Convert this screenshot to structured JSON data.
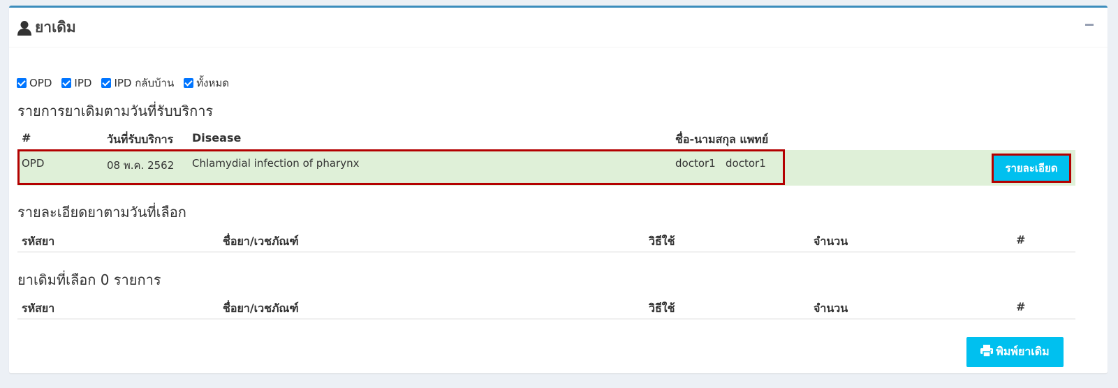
{
  "panel": {
    "title": "ยาเดิม",
    "title_icon": "user-icon",
    "collapse_icon": "minus-icon"
  },
  "filters": [
    {
      "label": "OPD",
      "checked": true
    },
    {
      "label": "IPD",
      "checked": true
    },
    {
      "label": "IPD กลับบ้าน",
      "checked": true
    },
    {
      "label": "ทั้งหมด",
      "checked": true
    }
  ],
  "visits": {
    "title": "รายการยาเดิมตามวันที่รับบริการ",
    "columns": [
      "#",
      "วันที่รับบริการ",
      "Disease",
      "ชื่อ-นามสกุล แพทย์"
    ],
    "rows": [
      {
        "type": "OPD",
        "date": "08 พ.ค. 2562",
        "disease": "Chlamydial infection of pharynx",
        "doctor": "doctor1   doctor1",
        "action_label": "รายละเอียด"
      }
    ]
  },
  "detail": {
    "title": "รายละเอียดยาตามวันที่เลือก",
    "columns": [
      "รหัสยา",
      "ชื่อยา/เวชภัณฑ์",
      "วิธีใช้",
      "จำนวน",
      "#"
    ]
  },
  "selected": {
    "title": "ยาเดิมที่เลือก 0 รายการ",
    "columns": [
      "รหัสยา",
      "ชื่อยา/เวชภัณฑ์",
      "วิธีใช้",
      "จำนวน",
      "#"
    ]
  },
  "print_button": {
    "label": "พิมพ์ยาเดิม",
    "icon": "print-icon"
  },
  "colors": {
    "accent": "#3c8dbc",
    "info": "#00c0ef",
    "row_success": "#dff0d8",
    "highlight": "#b30000"
  }
}
